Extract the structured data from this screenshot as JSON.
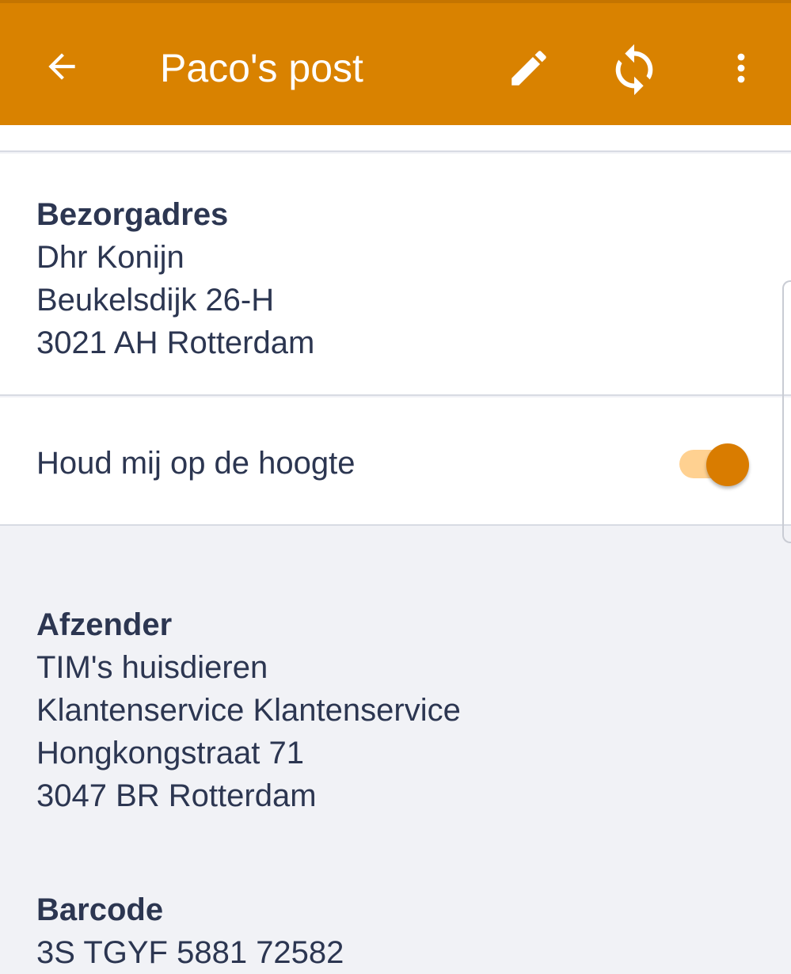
{
  "app_bar": {
    "title": "Paco's post",
    "color": "#d98200",
    "icons": [
      "arrow-back-icon",
      "pencil-icon",
      "refresh-icon",
      "more-vert-icon"
    ]
  },
  "delivery": {
    "heading": "Bezorgadres",
    "lines": [
      "Dhr Konijn",
      "Beukelsdijk 26-H",
      "3021 AH Rotterdam"
    ]
  },
  "notify": {
    "label": "Houd mij op de hoogte",
    "enabled": true
  },
  "sender": {
    "heading": "Afzender",
    "lines": [
      "TIM's huisdieren",
      "Klantenservice Klantenservice",
      "Hongkongstraat 71",
      "3047 BR Rotterdam"
    ]
  },
  "barcode": {
    "heading": "Barcode",
    "value": "3S TGYF 5881 72582"
  }
}
